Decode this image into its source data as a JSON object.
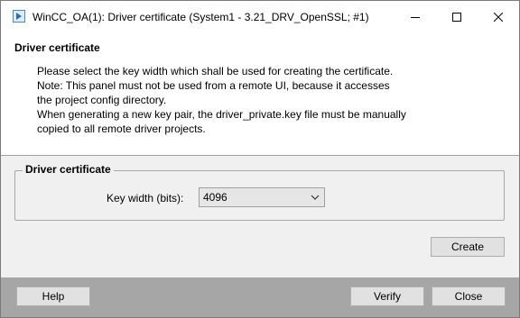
{
  "window": {
    "title": "WinCC_OA(1): Driver certificate (System1 - 3.21_DRV_OpenSSL; #1)",
    "icon": "wincc-app-icon"
  },
  "window_controls": {
    "minimize_icon": "minimize-icon",
    "maximize_icon": "maximize-icon",
    "close_icon": "close-icon"
  },
  "header": {
    "title": "Driver certificate",
    "lines": [
      "Please select the key width which shall be used for creating the certificate.",
      "Note: This panel must not be used from a remote UI, because it accesses",
      "the project config directory.",
      "When generating a new key pair, the driver_private.key file must be manually",
      "copied to all remote driver projects."
    ]
  },
  "group": {
    "title": "Driver certificate",
    "key_width_label": "Key width (bits):",
    "key_width_value": "4096"
  },
  "buttons": {
    "create": "Create",
    "help": "Help",
    "verify": "Verify",
    "close": "Close"
  }
}
